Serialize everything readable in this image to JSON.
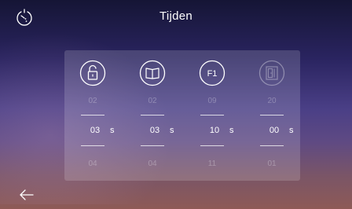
{
  "header": {
    "title": "Tijden"
  },
  "icons": {
    "top_left": "timer-icon",
    "bottom_left": "back-arrow-icon"
  },
  "columns": [
    {
      "icon": "unlock-icon",
      "icon_label": "",
      "prev": "02",
      "current": "03",
      "unit": "s",
      "next": "04"
    },
    {
      "icon": "book-icon",
      "icon_label": "",
      "prev": "02",
      "current": "03",
      "unit": "s",
      "next": "04"
    },
    {
      "icon": "f1-icon",
      "icon_label": "F1",
      "prev": "09",
      "current": "10",
      "unit": "s",
      "next": "11"
    },
    {
      "icon": "door-icon",
      "icon_label": "",
      "prev": "20",
      "current": "00",
      "unit": "s",
      "next": "01"
    }
  ]
}
